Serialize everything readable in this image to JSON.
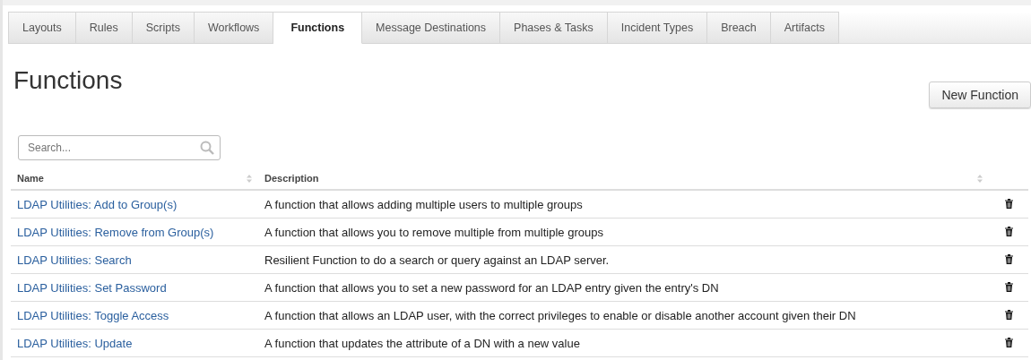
{
  "tabs": [
    {
      "label": "Layouts",
      "selected": false
    },
    {
      "label": "Rules",
      "selected": false
    },
    {
      "label": "Scripts",
      "selected": false
    },
    {
      "label": "Workflows",
      "selected": false
    },
    {
      "label": "Functions",
      "selected": true
    },
    {
      "label": "Message Destinations",
      "selected": false
    },
    {
      "label": "Phases & Tasks",
      "selected": false
    },
    {
      "label": "Incident Types",
      "selected": false
    },
    {
      "label": "Breach",
      "selected": false
    },
    {
      "label": "Artifacts",
      "selected": false
    }
  ],
  "page_title": "Functions",
  "new_button": "New Function",
  "search": {
    "placeholder": "Search..."
  },
  "table": {
    "columns": [
      "Name",
      "Description"
    ],
    "rows": [
      {
        "name": "LDAP Utilities: Add to Group(s)",
        "description": "A function that allows adding multiple users to multiple groups"
      },
      {
        "name": "LDAP Utilities: Remove from Group(s)",
        "description": "A function that allows you to remove multiple from multiple groups"
      },
      {
        "name": "LDAP Utilities: Search",
        "description": "Resilient Function to do a search or query against an LDAP server."
      },
      {
        "name": "LDAP Utilities: Set Password",
        "description": "A function that allows you to set a new password for an LDAP entry given the entry's DN"
      },
      {
        "name": "LDAP Utilities: Toggle Access",
        "description": "A function that allows an LDAP user, with the correct privileges to enable or disable another account given their DN"
      },
      {
        "name": "LDAP Utilities: Update",
        "description": "A function that updates the attribute of a DN with a new value"
      }
    ]
  }
}
